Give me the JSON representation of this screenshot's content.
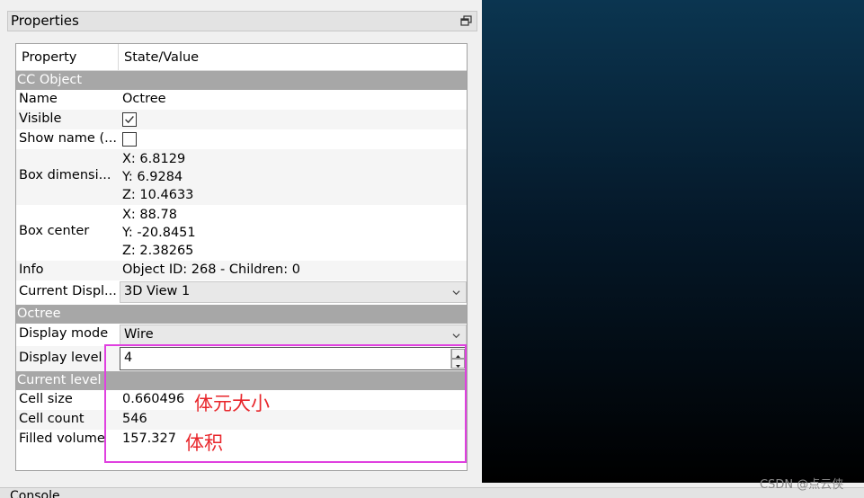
{
  "panel": {
    "title": "Properties"
  },
  "table": {
    "col_property": "Property",
    "col_value": "State/Value",
    "sections": {
      "cc_object": "CC Object",
      "octree": "Octree",
      "current_level": "Current level"
    },
    "rows": {
      "name": {
        "label": "Name",
        "value": "Octree"
      },
      "visible": {
        "label": "Visible",
        "checked": true
      },
      "show_name": {
        "label": "Show name (...",
        "checked": false
      },
      "box_dimensions": {
        "label": "Box dimensi...",
        "x": "X: 6.8129",
        "y": "Y: 6.9284",
        "z": "Z: 10.4633"
      },
      "box_center": {
        "label": "Box center",
        "x": "X: 88.78",
        "y": "Y: -20.8451",
        "z": "Z: 2.38265"
      },
      "info": {
        "label": "Info",
        "value": "Object ID: 268 - Children: 0"
      },
      "current_display": {
        "label": "Current Displ...",
        "value": "3D View 1"
      },
      "display_mode": {
        "label": "Display mode",
        "value": "Wire"
      },
      "display_level": {
        "label": "Display level",
        "value": "4"
      },
      "cell_size": {
        "label": "Cell size",
        "value": "0.660496"
      },
      "cell_count": {
        "label": "Cell count",
        "value": "546"
      },
      "filled_volume": {
        "label": "Filled volume",
        "value": "157.327"
      }
    }
  },
  "annotations": {
    "cell_size_note": "体元大小",
    "volume_note": "体积"
  },
  "console": {
    "title": "Console"
  },
  "watermark": "CSDN @点云侠",
  "colors": {
    "highlight": "#e040e0",
    "annotation": "#e8262b",
    "section_bg": "#a7a7a7"
  }
}
